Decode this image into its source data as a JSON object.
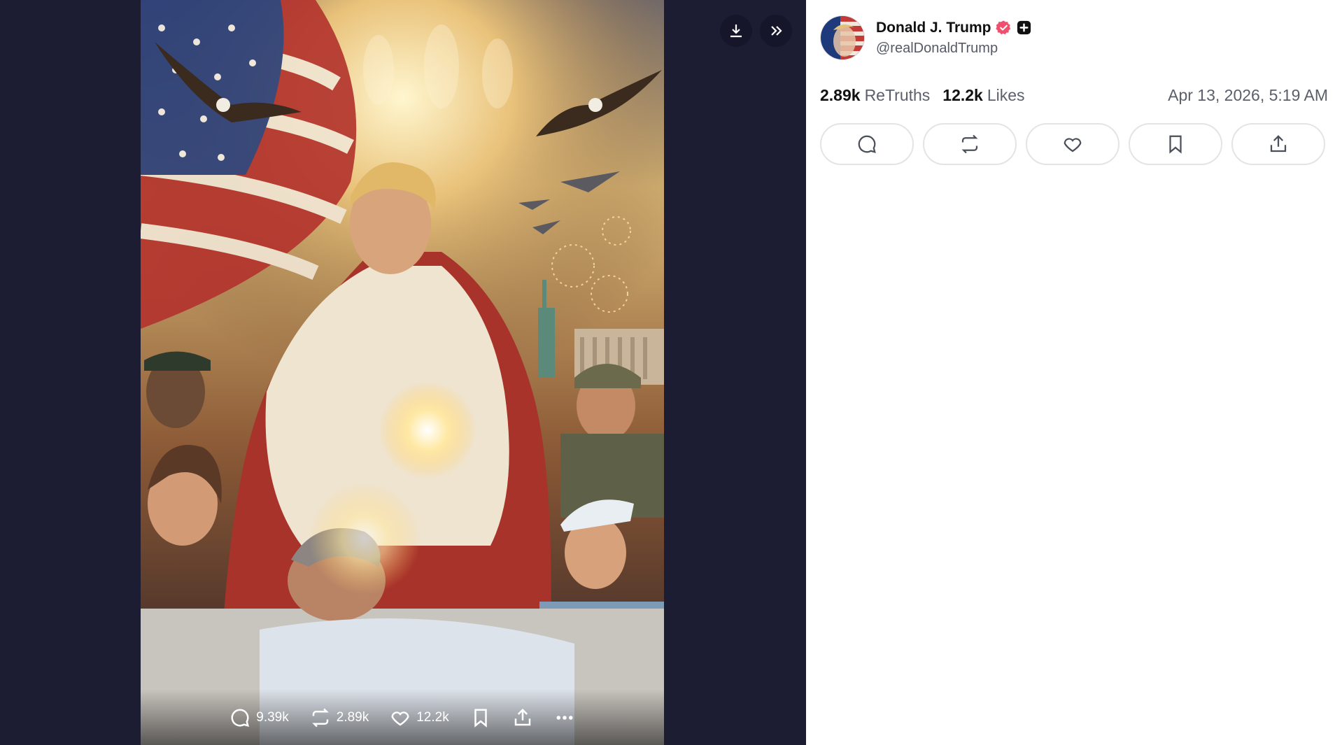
{
  "post": {
    "author_name": "Donald J. Trump",
    "handle": "@realDonaldTrump",
    "retruths_count": "2.89k",
    "retruths_label": "ReTruths",
    "likes_count": "12.2k",
    "likes_label": "Likes",
    "date": "Apr 13, 2026, 5:19 AM"
  },
  "media_actions": {
    "replies": "9.39k",
    "retruths": "2.89k",
    "likes": "12.2k"
  },
  "colors": {
    "viewer_background": "#1c1c33",
    "verified_badge": "#f0506e",
    "accent_dark": "#111111"
  },
  "icons": {
    "viewer": [
      "download-icon",
      "chevrons-right-icon"
    ],
    "media_actions": [
      "reply-icon",
      "retruth-icon",
      "like-icon",
      "bookmark-icon",
      "share-icon",
      "more-icon"
    ],
    "panel_actions": [
      "reply-icon",
      "retruth-icon",
      "like-icon",
      "bookmark-icon",
      "share-icon"
    ],
    "badges": [
      "verified-badge-icon",
      "plus-badge-icon"
    ]
  }
}
